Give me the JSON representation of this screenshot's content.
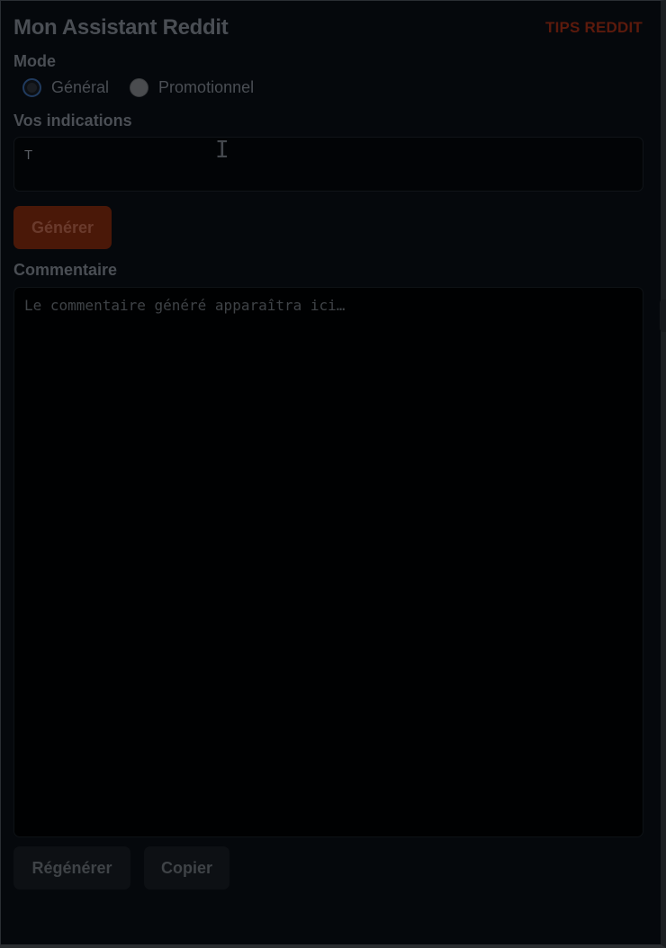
{
  "app": {
    "title": "Mon Assistant Reddit",
    "tips_link": "TIPS REDDIT"
  },
  "mode": {
    "label": "Mode",
    "options": [
      {
        "label": "Général",
        "selected": true
      },
      {
        "label": "Promotionnel",
        "selected": false
      }
    ]
  },
  "indications": {
    "label": "Vos indications",
    "value": "T"
  },
  "actions": {
    "generate_label": "Générer",
    "regenerate_label": "Régénérer",
    "copy_label": "Copier"
  },
  "comment": {
    "label": "Commentaire",
    "placeholder": "Le commentaire généré apparaîtra ici…",
    "value": ""
  },
  "colors": {
    "accent": "#4a1808",
    "background": "#05080c"
  }
}
